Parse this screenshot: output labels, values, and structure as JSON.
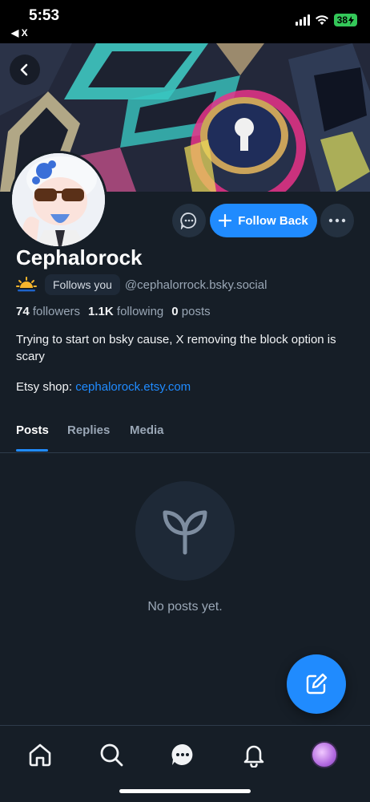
{
  "status_bar": {
    "time": "5:53",
    "back_app": "◀ X",
    "battery": "38"
  },
  "icons": {
    "back": "chevron-left-icon",
    "chat": "chat-bubble-icon",
    "follow": "plus-icon",
    "more": "ellipsis-icon",
    "empty": "sprout-icon",
    "compose": "compose-icon",
    "nav": [
      "home-icon",
      "search-icon",
      "messages-icon",
      "bell-icon"
    ]
  },
  "colors": {
    "accent": "#208bfe",
    "background": "#161e27",
    "muted_text": "#9aa7b6"
  },
  "profile": {
    "display_name": "Cephalorock",
    "follows_you": "Follows you",
    "handle": "@cephalorrock.bsky.social",
    "emoji": "🌅",
    "stats": {
      "followers_count": "74",
      "followers_label": "followers",
      "following_count": "1.1K",
      "following_label": "following",
      "posts_count": "0",
      "posts_label": "posts"
    },
    "bio": "Trying to start on bsky cause, X removing the block option is scary",
    "etsy_label": "Etsy shop:",
    "etsy_link": "cephalorock.etsy.com"
  },
  "actions": {
    "follow_back": "Follow Back"
  },
  "tabs": [
    {
      "label": "Posts",
      "active": true
    },
    {
      "label": "Replies",
      "active": false
    },
    {
      "label": "Media",
      "active": false
    }
  ],
  "empty_state": {
    "text": "No posts yet."
  }
}
